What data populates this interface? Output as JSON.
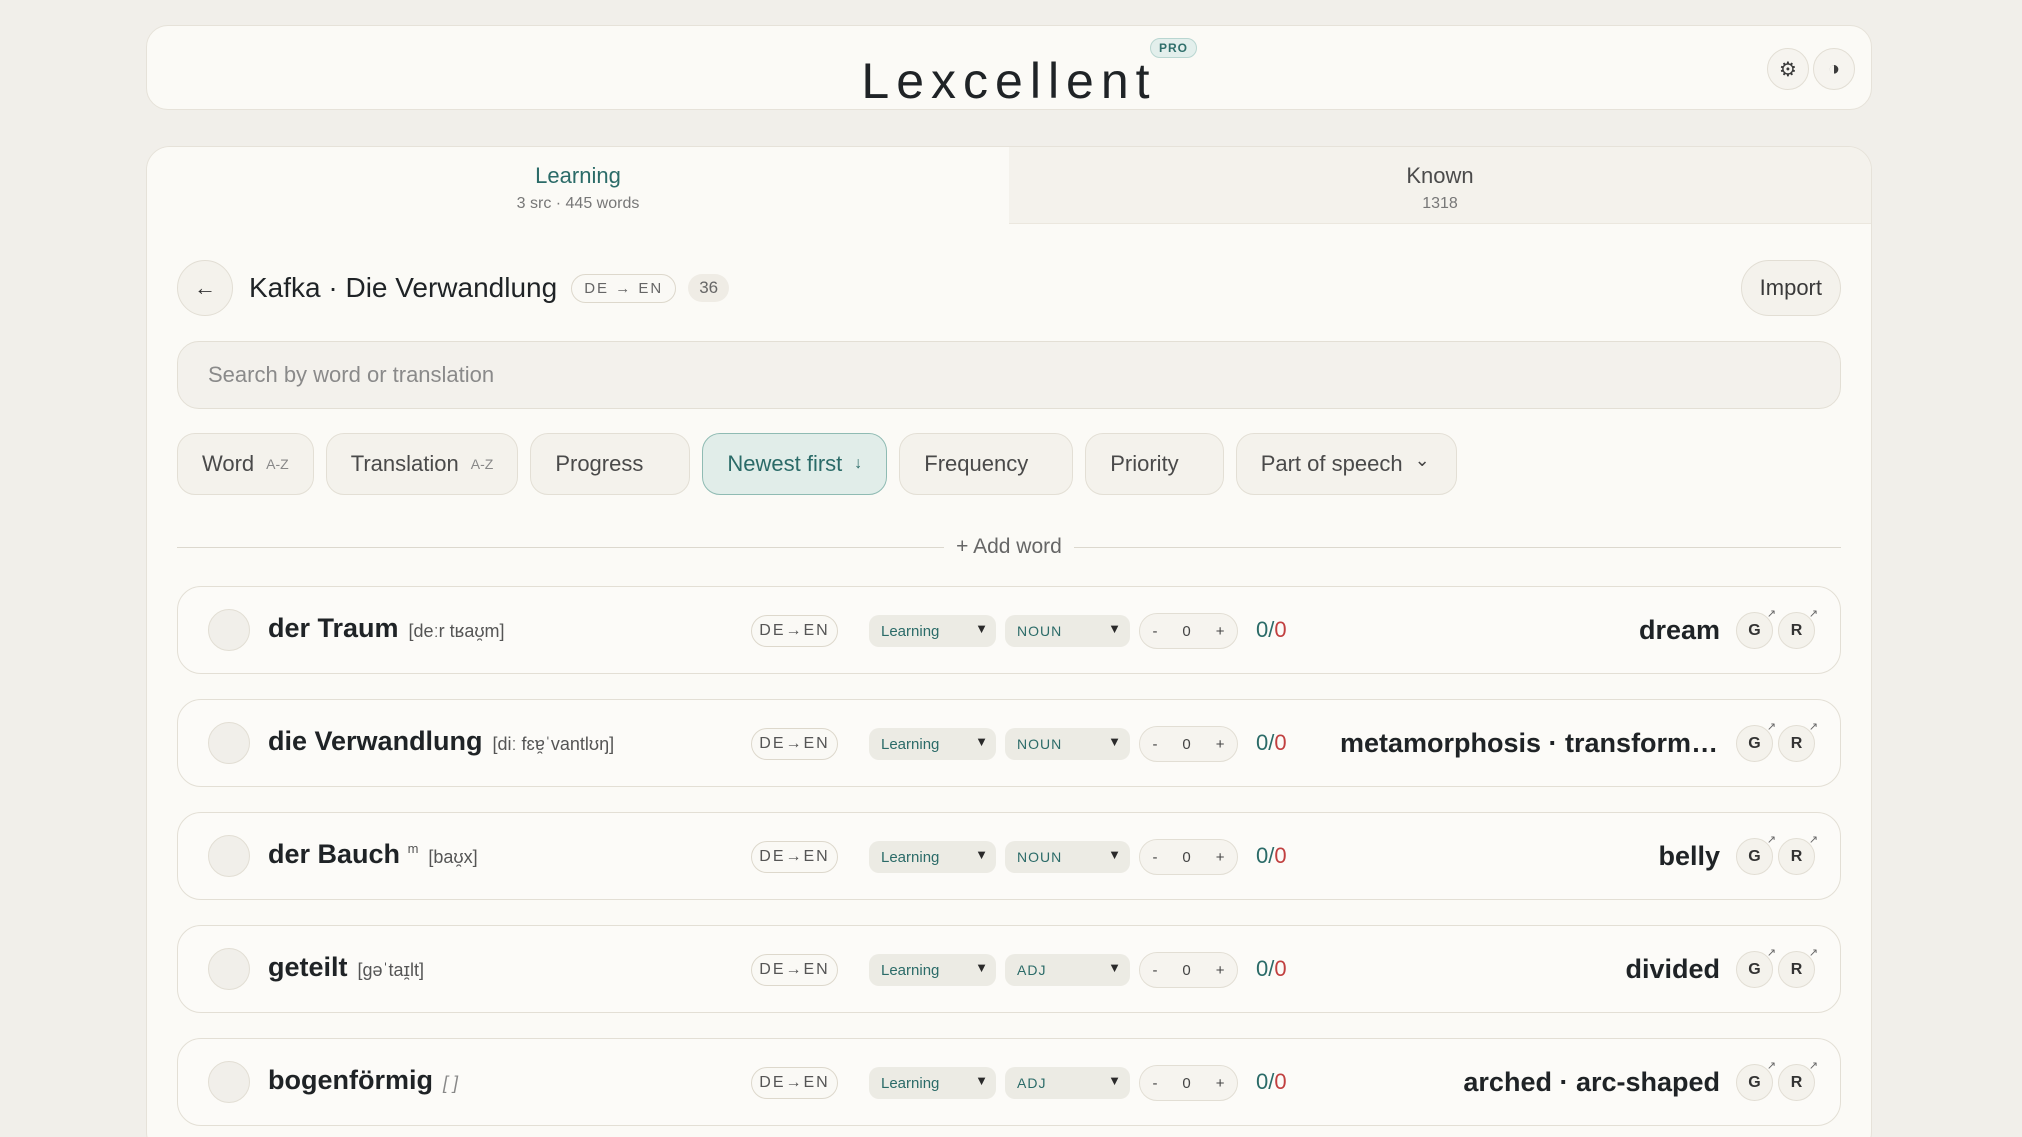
{
  "app": {
    "title": "Lexcellent",
    "badge": "PRO",
    "settings_icon": "gear-icon",
    "theme_icon": "contrast-icon"
  },
  "tabs": [
    {
      "label": "Learning",
      "sub": "3 src · 445 words",
      "active": true
    },
    {
      "label": "Known",
      "sub": "1318",
      "active": false
    }
  ],
  "source": {
    "title": "Kafka · Die Verwandlung",
    "lang": "DE → EN",
    "count": "36",
    "import_label": "Import"
  },
  "search": {
    "placeholder": "Search by word or translation"
  },
  "sorts": [
    {
      "label": "Word",
      "hint": "A-Z"
    },
    {
      "label": "Translation",
      "hint": "A-Z"
    },
    {
      "label": "Progress",
      "hint": ""
    },
    {
      "label": "Newest first",
      "hint": "↓",
      "active": true
    },
    {
      "label": "Frequency",
      "hint": ""
    },
    {
      "label": "Priority",
      "hint": ""
    },
    {
      "label": "Part of speech",
      "hint": "⌄"
    }
  ],
  "add_word_label": "+ Add word",
  "words": [
    {
      "word": "der Traum",
      "gender": "",
      "ipa": "[deːr tʁaʊ̯m]",
      "dir": "DE→EN",
      "status": "Learning",
      "pos": "NOUN",
      "step": "0",
      "score_num": "0",
      "score_den": "0",
      "translation": "dream"
    },
    {
      "word": "die Verwandlung",
      "gender": "",
      "ipa": "[diː fɛɐ̯ˈvantlʊŋ]",
      "dir": "DE→EN",
      "status": "Learning",
      "pos": "NOUN",
      "step": "0",
      "score_num": "0",
      "score_den": "0",
      "translation": "metamorphosis · transformat..."
    },
    {
      "word": "der Bauch",
      "gender": "m",
      "ipa": "[baʊ̯x]",
      "dir": "DE→EN",
      "status": "Learning",
      "pos": "NOUN",
      "step": "0",
      "score_num": "0",
      "score_den": "0",
      "translation": "belly"
    },
    {
      "word": "geteilt",
      "gender": "",
      "ipa": "[ɡəˈtaɪ̯lt]",
      "dir": "DE→EN",
      "status": "Learning",
      "pos": "ADJ",
      "step": "0",
      "score_num": "0",
      "score_den": "0",
      "translation": "divided"
    },
    {
      "word": "bogenförmig",
      "gender": "",
      "ipa": "[ ]",
      "dir": "DE→EN",
      "status": "Learning",
      "pos": "ADJ",
      "step": "0",
      "score_num": "0",
      "score_den": "0",
      "translation": "arched · arc-shaped"
    }
  ],
  "row_actions": {
    "g": "G",
    "r": "R",
    "minus": "-",
    "plus": "+",
    "external_icon": "external-link-icon"
  }
}
